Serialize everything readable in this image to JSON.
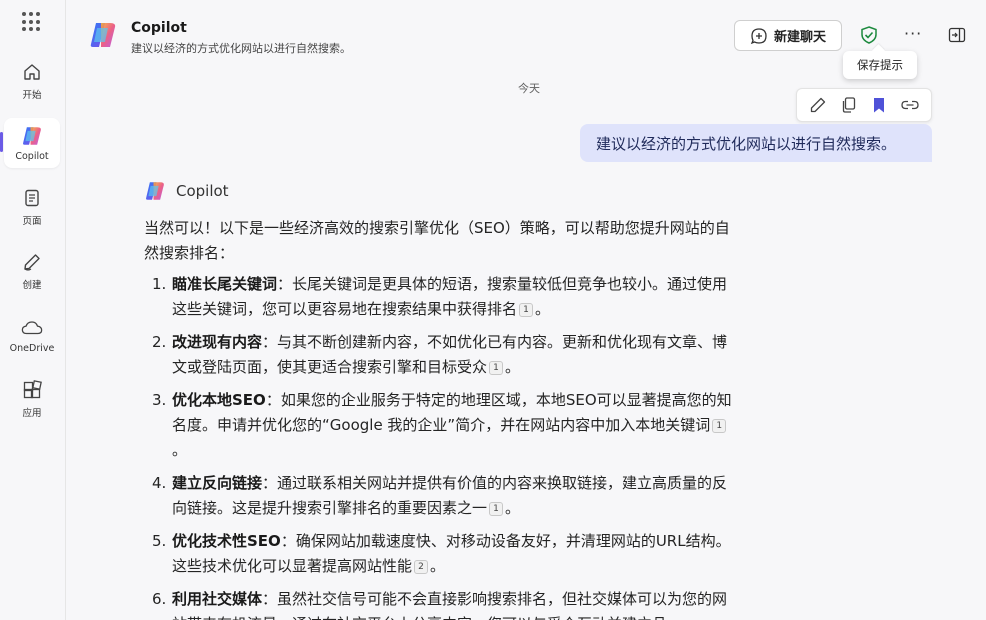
{
  "rail": {
    "items": [
      {
        "label": "开始",
        "icon": "home-icon"
      },
      {
        "label": "Copilot",
        "icon": "copilot-icon",
        "active": true
      },
      {
        "label": "页面",
        "icon": "page-icon"
      },
      {
        "label": "创建",
        "icon": "pen-icon"
      },
      {
        "label": "OneDrive",
        "icon": "cloud-icon"
      },
      {
        "label": "应用",
        "icon": "apps-icon"
      }
    ]
  },
  "header": {
    "title": "Copilot",
    "subtitle": "建议以经济的方式优化网站以进行自然搜索。",
    "new_chat_label": "新建聊天",
    "more_label": "···"
  },
  "tooltip": "保存提示",
  "day_label": "今天",
  "user_message": "建议以经济的方式优化网站以进行自然搜索。",
  "bot": {
    "name": "Copilot",
    "intro": "当然可以！以下是一些经济高效的搜索引擎优化（SEO）策略，可以帮助您提升网站的自然搜索排名：",
    "items": [
      {
        "num": "1.",
        "title": "瞄准长尾关键词",
        "text": "：长尾关键词是更具体的短语，搜索量较低但竞争也较小。通过使用这些关键词，您可以更容易地在搜索结果中获得排名",
        "cite": "1",
        "end": "。"
      },
      {
        "num": "2.",
        "title": "改进现有内容",
        "text": "：与其不断创建新内容，不如优化已有内容。更新和优化现有文章、博文或登陆页面，使其更适合搜索引擎和目标受众",
        "cite": "1",
        "end": "。"
      },
      {
        "num": "3.",
        "title": "优化本地SEO",
        "text": "：如果您的企业服务于特定的地理区域，本地SEO可以显著提高您的知名度。申请并优化您的“Google 我的企业”简介，并在网站内容中加入本地关键词",
        "cite": "1",
        "end": "。"
      },
      {
        "num": "4.",
        "title": "建立反向链接",
        "text": "：通过联系相关网站并提供有价值的内容来换取链接，建立高质量的反向链接。这是提升搜索引擎排名的重要因素之一",
        "cite": "1",
        "end": "。"
      },
      {
        "num": "5.",
        "title": "优化技术性SEO",
        "text": "：确保网站加载速度快、对移动设备友好，并清理网站的URL结构。这些技术优化可以显著提高网站性能",
        "cite": "2",
        "end": "。"
      },
      {
        "num": "6.",
        "title": "利用社交媒体",
        "text": "：虽然社交信号可能不会直接影响搜索排名，但社交媒体可以为您的网站带来有机流量。通过在社交平台上分享内容，您可以与受众互动并建立品",
        "cite": "",
        "end": ""
      }
    ]
  },
  "colors": {
    "accent": "#6b5be6",
    "user_bubble": "#dfe3fb",
    "bookmark": "#4f52d8",
    "shield": "#1d8a3e"
  }
}
